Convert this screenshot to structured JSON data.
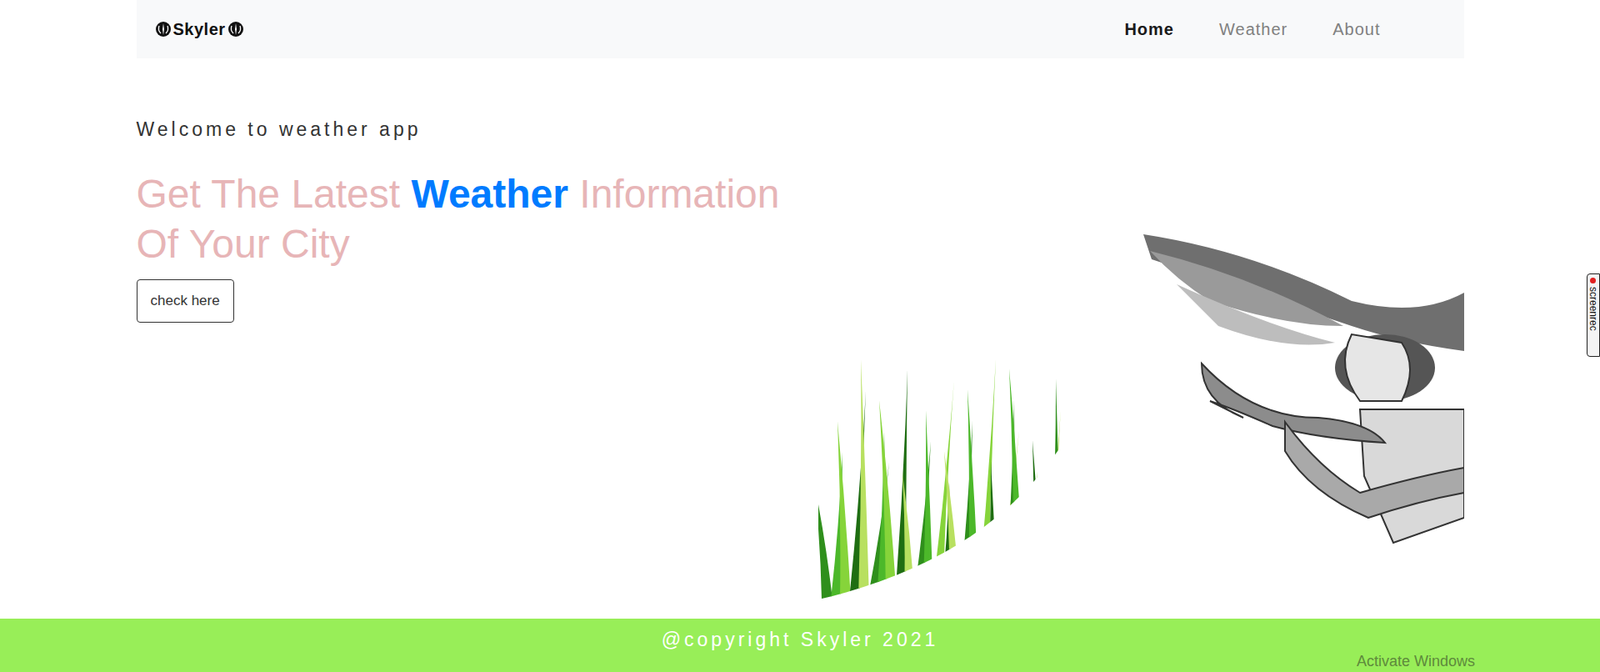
{
  "navbar": {
    "brand": "Skyler",
    "links": [
      {
        "label": "Home",
        "selected": true
      },
      {
        "label": "Weather",
        "selected": false
      },
      {
        "label": "About",
        "selected": false
      }
    ]
  },
  "hero": {
    "kicker": "Welcome to weather app",
    "headline": [
      {
        "text": "Get The Latest ",
        "highlight": false
      },
      {
        "text": "Weather",
        "highlight": true
      },
      {
        "text": " Information Of Your City",
        "highlight": false
      }
    ],
    "button": "check here"
  },
  "footer": {
    "text": "@copyright Skyler 2021"
  },
  "overlays": {
    "recorder_tab": "screenrec",
    "watermark": "Activate Windows"
  }
}
